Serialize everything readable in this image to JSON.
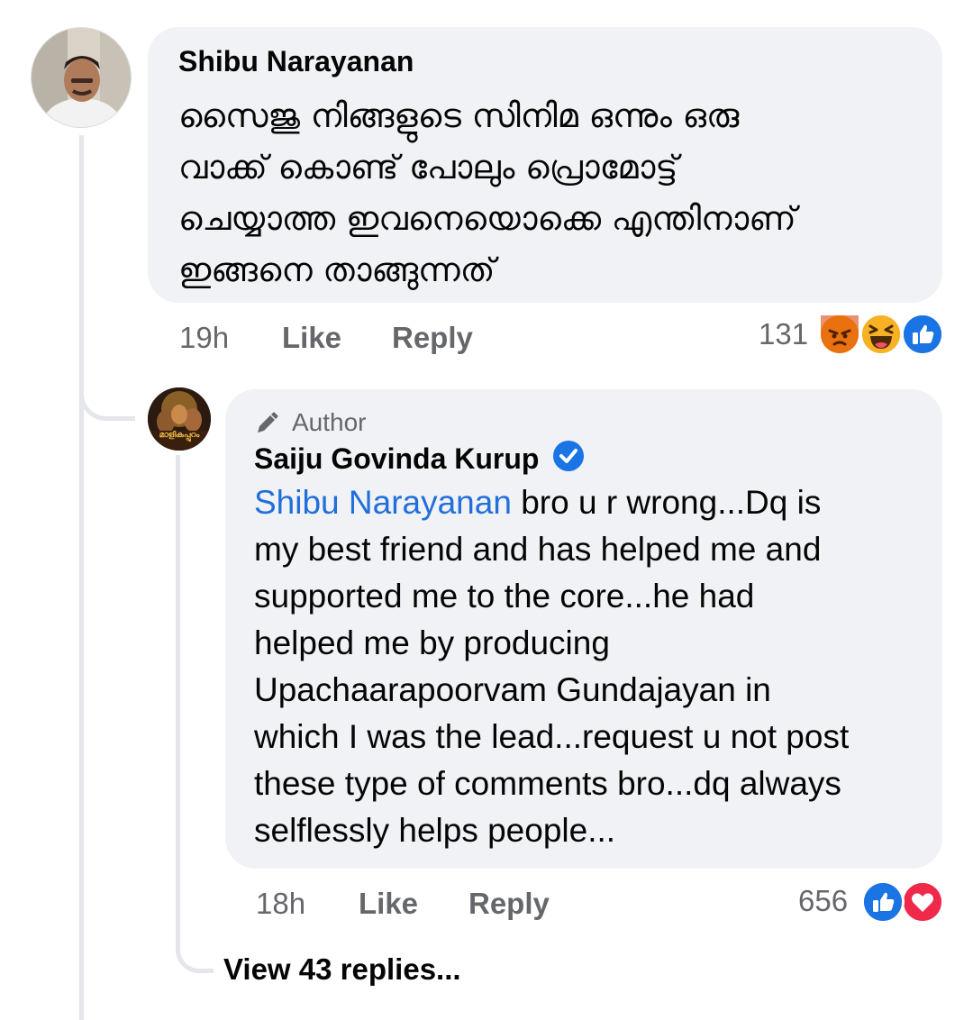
{
  "comment": {
    "author": "Shibu Narayanan",
    "text_lines": [
      "സൈജു നിങ്ങളുടെ സിനിമ ഒന്നും ഒരു",
      "വാക്ക് കൊണ്ട് പോലും പ്രൊമോട്ട്",
      "ചെയ്യാത്ത ഇവനെയൊക്കെ എന്തിനാണ്",
      "ഇങ്ങനെ താങ്ങുന്നത്"
    ],
    "time": "19h",
    "like_label": "Like",
    "reply_label": "Reply",
    "reaction_count": "131",
    "reactions": [
      "angry-icon",
      "haha-icon",
      "like-icon"
    ]
  },
  "reply": {
    "badge": "Author",
    "author": "Saiju Govinda Kurup",
    "verified": true,
    "mention": "Shibu Narayanan",
    "text_lines": [
      " bro u r wrong...Dq is",
      "my best friend and has helped me and",
      "supported me to the core...he had",
      "helped me by producing",
      "Upachaarapoorvam Gundajayan in",
      "which I was the lead...request u not post",
      "these type of comments bro...dq always",
      "selflessly helps people..."
    ],
    "time": "18h",
    "like_label": "Like",
    "reply_label": "Reply",
    "reaction_count": "656",
    "reactions": [
      "like-icon",
      "love-icon"
    ],
    "avatar_caption": "മാളികപ്പുറം"
  },
  "view_replies": "View 43 replies...",
  "colors": {
    "link": "#216fdb",
    "bubble": "#f0f2f5",
    "meta": "#65676b",
    "like_blue": "#1b74e4",
    "love_red": "#f0284a",
    "angry_orange": "#e9710f",
    "haha_yellow": "#f7b125"
  }
}
